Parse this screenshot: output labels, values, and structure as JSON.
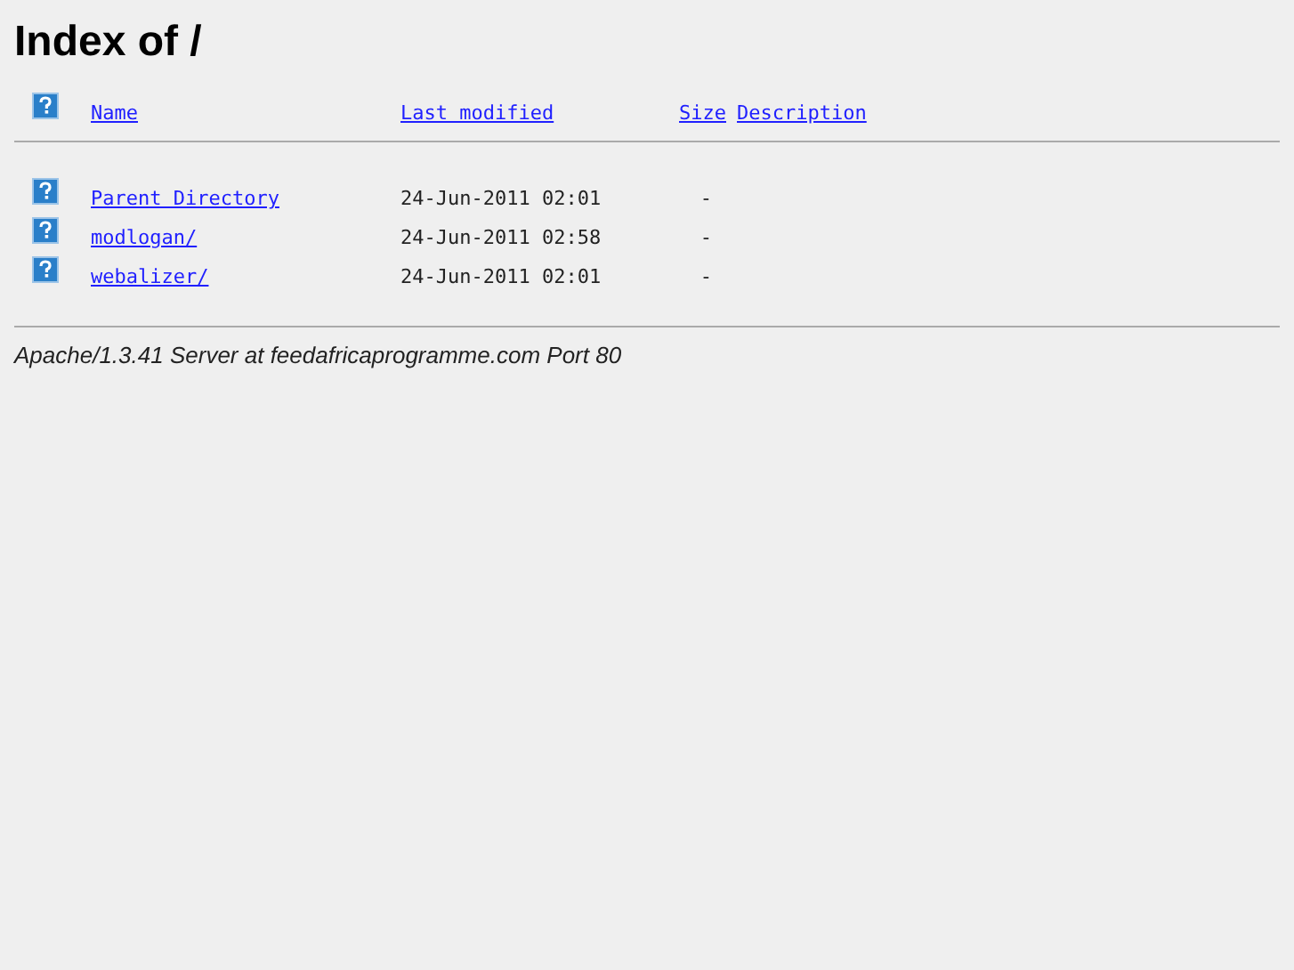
{
  "title": "Index of /",
  "columns": [
    "Name",
    "Last modified",
    "Size",
    "Description"
  ],
  "rows": [
    {
      "name": "Parent Directory",
      "modified": "24-Jun-2011 02:01",
      "size": "-"
    },
    {
      "name": "modlogan/",
      "modified": "24-Jun-2011 02:58",
      "size": "-"
    },
    {
      "name": "webalizer/",
      "modified": "24-Jun-2011 02:01",
      "size": "-"
    }
  ],
  "footer": "Apache/1.3.41 Server at feedafricaprogramme.com Port 80"
}
